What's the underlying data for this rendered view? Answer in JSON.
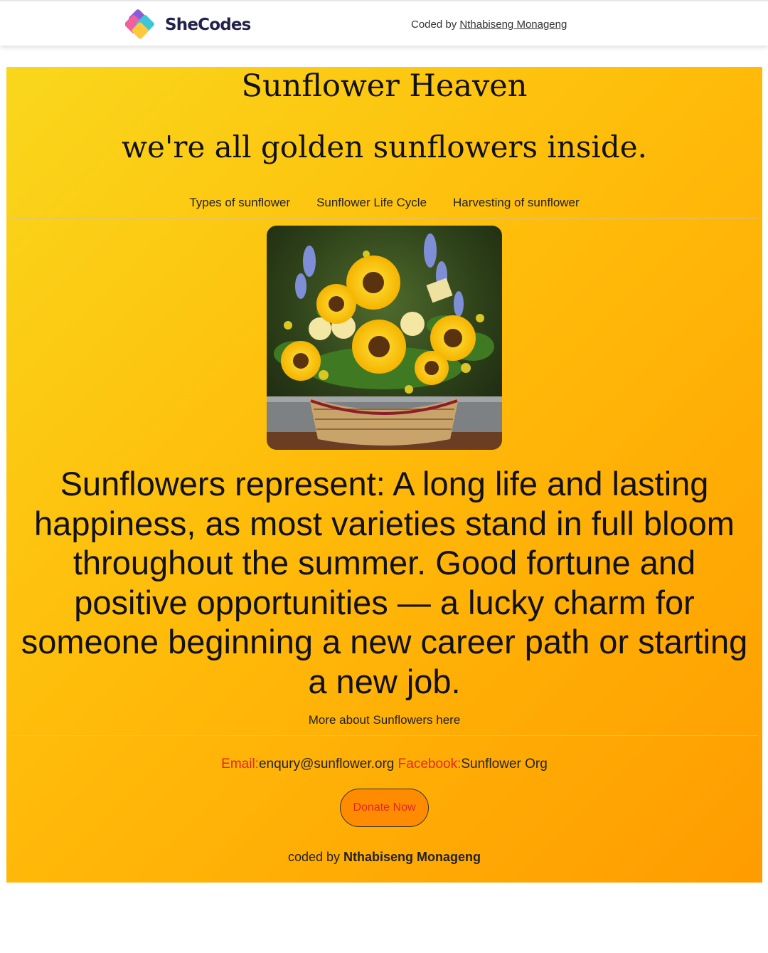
{
  "header": {
    "brand": "SheCodes",
    "coded_by_prefix": "Coded by ",
    "coded_by_name": "Nthabiseng Monageng"
  },
  "hero": {
    "title": "Sunflower Heaven",
    "tagline": "we're all golden sunflowers inside."
  },
  "nav": {
    "items": [
      {
        "label": "Types of sunflower"
      },
      {
        "label": "Sunflower Life Cycle"
      },
      {
        "label": "Harvesting of sunflower"
      }
    ]
  },
  "main": {
    "statement": "Sunflowers represent: A long life and lasting happiness, as most varieties stand in full bloom throughout the summer. Good fortune and positive opportunities — a lucky charm for someone beginning a new career path or starting a new job.",
    "more_link": "More about Sunflowers here"
  },
  "contact": {
    "email_label": "Email:",
    "email_value": "enqury@sunflower.org",
    "facebook_label": "Facebook:",
    "facebook_value": "Sunflower Org"
  },
  "donate": {
    "label": "Donate Now"
  },
  "footer": {
    "prefix": "coded by ",
    "name": "Nthabiseng Monageng"
  },
  "colors": {
    "gradient_start": "#f9d71c",
    "gradient_end": "#ff9c00",
    "label_red": "#e3261f",
    "brand_navy": "#23224b"
  }
}
